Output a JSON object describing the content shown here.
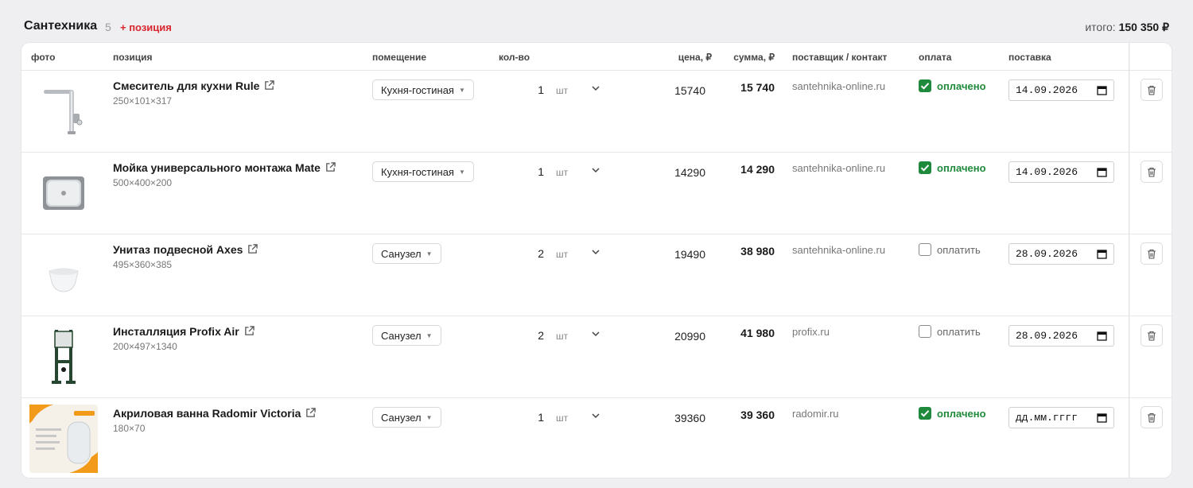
{
  "section": {
    "title": "Сантехника",
    "count": "5",
    "add_label": "+ позиция",
    "total_label": "итого:",
    "total_value": "150 350 ₽"
  },
  "columns": {
    "photo": "фото",
    "position": "позиция",
    "room": "помещение",
    "qty": "кол-во",
    "price": "цена, ₽",
    "sum": "сумма, ₽",
    "supplier": "поставщик / контакт",
    "payment": "оплата",
    "delivery": "поставка"
  },
  "rows": [
    {
      "name": "Смеситель для кухни Rule",
      "dims": "250×101×317",
      "photo_icon": "faucet-icon",
      "room": "Кухня-гостиная",
      "qty": "1",
      "unit": "шт",
      "price": "15740",
      "sum": "15 740",
      "supplier": "santehnika-online.ru",
      "paid": true,
      "pay_label": "оплачено",
      "date": "14.09.2026"
    },
    {
      "name": "Мойка универсального монтажа Mate",
      "dims": "500×400×200",
      "photo_icon": "sink-icon",
      "room": "Кухня-гостиная",
      "qty": "1",
      "unit": "шт",
      "price": "14290",
      "sum": "14 290",
      "supplier": "santehnika-online.ru",
      "paid": true,
      "pay_label": "оплачено",
      "date": "14.09.2026"
    },
    {
      "name": "Унитаз подвесной Axes",
      "dims": "495×360×385",
      "photo_icon": "toilet-icon",
      "room": "Санузел",
      "qty": "2",
      "unit": "шт",
      "price": "19490",
      "sum": "38 980",
      "supplier": "santehnika-online.ru",
      "paid": false,
      "pay_label": "оплатить",
      "date": "28.09.2026"
    },
    {
      "name": "Инсталляция Profix Air",
      "dims": "200×497×1340",
      "photo_icon": "installation-frame-icon",
      "room": "Санузел",
      "qty": "2",
      "unit": "шт",
      "price": "20990",
      "sum": "41 980",
      "supplier": "profix.ru",
      "paid": false,
      "pay_label": "оплатить",
      "date": "28.09.2026"
    },
    {
      "name": "Акриловая ванна Radomir Victoria",
      "dims": "180×70",
      "photo_icon": "bathtub-package-icon",
      "room": "Санузел",
      "qty": "1",
      "unit": "шт",
      "price": "39360",
      "sum": "39 360",
      "supplier": "radomir.ru",
      "paid": true,
      "pay_label": "оплачено",
      "date": "дд.мм.гггг"
    }
  ],
  "colors": {
    "accent_red": "#d8262c",
    "paid_green": "#1f8a3b",
    "page_bg": "#efeff1"
  }
}
